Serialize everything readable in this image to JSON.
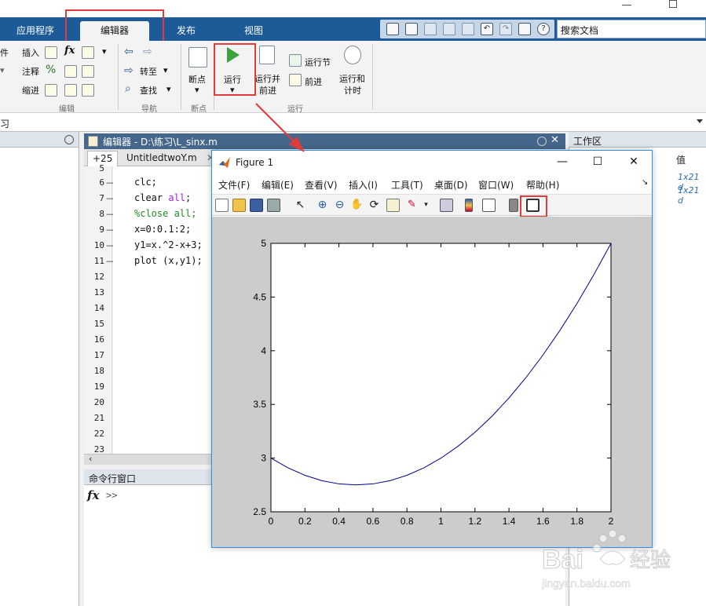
{
  "ribbon_tabs": [
    "应用程序",
    "编辑器",
    "发布",
    "视图"
  ],
  "search": {
    "placeholder": "搜索文档"
  },
  "ribbon": {
    "file_label": "件",
    "insert": "插入",
    "comment": "注释",
    "indent": "缩进",
    "goto": "转至",
    "find": "查找",
    "breakpoint": "断点",
    "run": "运行",
    "run_advance": [
      "运行并",
      "前进"
    ],
    "run_section": "运行节",
    "advance": "前进",
    "run_time": [
      "运行和",
      "计时"
    ],
    "groups": {
      "edit": "编辑",
      "navigate": "导航",
      "breakpoints": "断点",
      "run": "运行"
    }
  },
  "path_bar": {
    "text": "习"
  },
  "editor": {
    "title": "编辑器 - D:\\练习\\L_sinx.m",
    "tabs": [
      "+25",
      "UntitledtwoY.m"
    ],
    "lines": [
      {
        "n": "6",
        "code": "clc;"
      },
      {
        "n": "7",
        "code_a": "clear ",
        "code_kw": "all",
        "code_b": ";"
      },
      {
        "n": "8",
        "comment": "%close all;"
      },
      {
        "n": "9",
        "code": "x=0:0.1:2;"
      },
      {
        "n": "10",
        "code": "y1=x.^2-x+3;"
      },
      {
        "n": "11",
        "code": "plot (x,y1);"
      }
    ],
    "empty_lines": [
      "12",
      "13",
      "14",
      "15",
      "16",
      "17",
      "18",
      "19",
      "20",
      "21",
      "22",
      "23"
    ],
    "partial_line": "5"
  },
  "command_window": {
    "title": "命令行窗口",
    "prompt": ">>"
  },
  "workspace": {
    "title": "工作区",
    "col_value": "值",
    "values": [
      "1x21 d",
      "1x21 d"
    ]
  },
  "figure": {
    "title": "Figure 1",
    "menu": [
      "文件(F)",
      "编辑(E)",
      "查看(V)",
      "插入(I)",
      "工具(T)",
      "桌面(D)",
      "窗口(W)",
      "帮助(H)"
    ],
    "close_glyph": "✕",
    "max_glyph": "☐",
    "min_glyph": "—"
  },
  "chart_data": {
    "type": "line",
    "title": "",
    "xlabel": "",
    "ylabel": "",
    "xlim": [
      0,
      2
    ],
    "ylim": [
      2.5,
      5
    ],
    "xticks": [
      "0",
      "0.2",
      "0.4",
      "0.6",
      "0.8",
      "1",
      "1.2",
      "1.4",
      "1.6",
      "1.8",
      "2"
    ],
    "yticks": [
      "2.5",
      "3",
      "3.5",
      "4",
      "4.5",
      "5"
    ],
    "grid": false,
    "series_color": "#00008b",
    "x": [
      0,
      0.1,
      0.2,
      0.3,
      0.4,
      0.5,
      0.6,
      0.7,
      0.8,
      0.9,
      1.0,
      1.1,
      1.2,
      1.3,
      1.4,
      1.5,
      1.6,
      1.7,
      1.8,
      1.9,
      2.0
    ],
    "y": [
      3.0,
      2.91,
      2.84,
      2.79,
      2.76,
      2.75,
      2.76,
      2.79,
      2.84,
      2.91,
      3.0,
      3.11,
      3.24,
      3.39,
      3.56,
      3.75,
      3.96,
      4.19,
      4.44,
      4.71,
      5.0
    ]
  },
  "watermark": {
    "brand": "Bai",
    "brand2": "经验",
    "url": "jingyan.baidu.com"
  },
  "colors": {
    "tab_bar": "#1c5b97",
    "highlight": "#e23b3b",
    "run_green": "#3aa43a"
  }
}
